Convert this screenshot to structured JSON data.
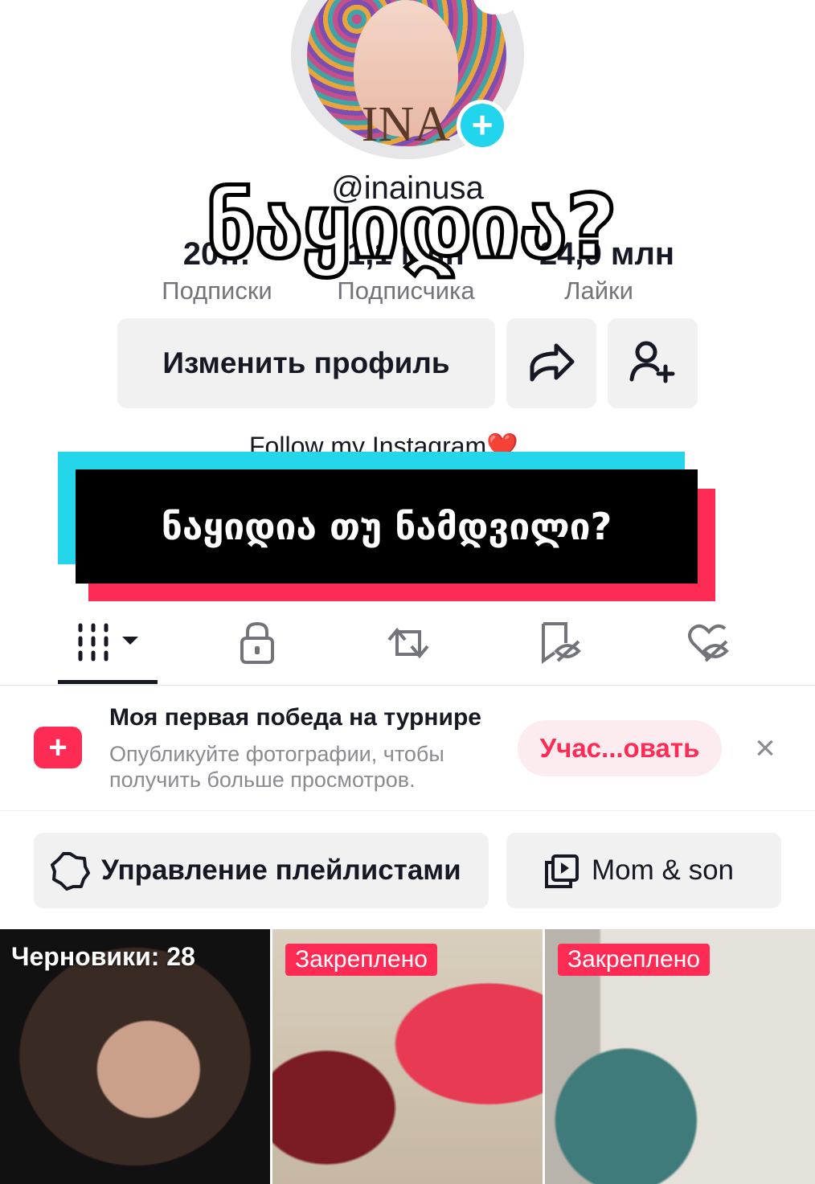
{
  "profile": {
    "avatar_text": "INA",
    "username": "@inainusa",
    "stats": [
      {
        "value": "20…",
        "label": "Подписки"
      },
      {
        "value": "1,1 млн",
        "label": "Подписчика"
      },
      {
        "value": "24,9 млн",
        "label": "Лайки"
      }
    ],
    "edit_label": "Изменить профиль",
    "bio": "Follow my Instagram❤️"
  },
  "overlay": {
    "caption_top": "ნაყიდია?",
    "banner_text": "ნაყიდია თუ ნამდვილი?"
  },
  "tabs": [
    "videos-grid-icon",
    "lock-icon",
    "repost-icon",
    "tagged-icon",
    "liked-icon"
  ],
  "promo": {
    "title": "Моя первая победа на турнире",
    "subtitle": "Опубликуйте фотографии, чтобы получить больше просмотров.",
    "button": "Учас...овать",
    "close": "×"
  },
  "playlists": {
    "manage_label": "Управление плейлистами",
    "mom_label": "Mom & son"
  },
  "grid": [
    {
      "label": "Черновики: 28"
    },
    {
      "label": "Закреплено"
    },
    {
      "label": "Закреплено"
    }
  ],
  "colors": {
    "accent_cyan": "#20d5ec",
    "accent_pink": "#fe2c55",
    "text_muted": "#73747b"
  }
}
